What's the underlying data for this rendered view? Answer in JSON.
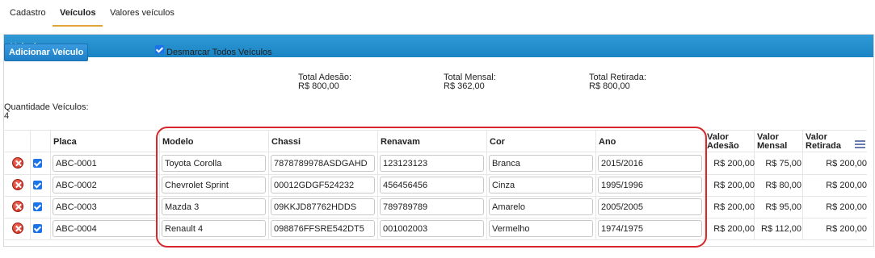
{
  "tabs": [
    "Cadastro",
    "Veículos",
    "Valores veículos"
  ],
  "panel_title": "Veículos",
  "add_button": "Adicionar Veículo",
  "toggle_all_label": "Desmarcar Todos Veículos",
  "totals": {
    "adesao_label": "Total Adesão:",
    "adesao_value": "R$ 800,00",
    "mensal_label": "Total Mensal:",
    "mensal_value": "R$ 362,00",
    "retirada_label": "Total Retirada:",
    "retirada_value": "R$ 800,00"
  },
  "quantity_label": "Quantidade Veículos:",
  "quantity_value": "4",
  "columns": {
    "placa": "Placa",
    "modelo": "Modelo",
    "chassi": "Chassi",
    "renavam": "Renavam",
    "cor": "Cor",
    "ano": "Ano",
    "adesao_1": "Valor",
    "adesao_2": "Adesão",
    "mensal_1": "Valor",
    "mensal_2": "Mensal",
    "retirada_1": "Valor",
    "retirada_2": "Retirada"
  },
  "rows": [
    {
      "placa": "ABC-0001",
      "modelo": "Toyota Corolla",
      "chassi": "7878789978ASDGAHD",
      "renavam": "123123123",
      "cor": "Branca",
      "ano": "2015/2016",
      "adesao": "R$ 200,00",
      "mensal": "R$ 75,00",
      "retirada": "R$ 200,00"
    },
    {
      "placa": "ABC-0002",
      "modelo": "Chevrolet Sprint",
      "chassi": "00012GDGF524232",
      "renavam": "456456456",
      "cor": "Cinza",
      "ano": "1995/1996",
      "adesao": "R$ 200,00",
      "mensal": "R$ 80,00",
      "retirada": "R$ 200,00"
    },
    {
      "placa": "ABC-0003",
      "modelo": "Mazda 3",
      "chassi": "09KKJD87762HDDS",
      "renavam": "789789789",
      "cor": "Amarelo",
      "ano": "2005/2005",
      "adesao": "R$ 200,00",
      "mensal": "R$ 95,00",
      "retirada": "R$ 200,00"
    },
    {
      "placa": "ABC-0004",
      "modelo": "Renault 4",
      "chassi": "098876FFSRE542DT5",
      "renavam": "001002003",
      "cor": "Vermelho",
      "ano": "1974/1975",
      "adesao": "R$ 200,00",
      "mensal": "R$ 112,00",
      "retirada": "R$ 200,00"
    }
  ]
}
